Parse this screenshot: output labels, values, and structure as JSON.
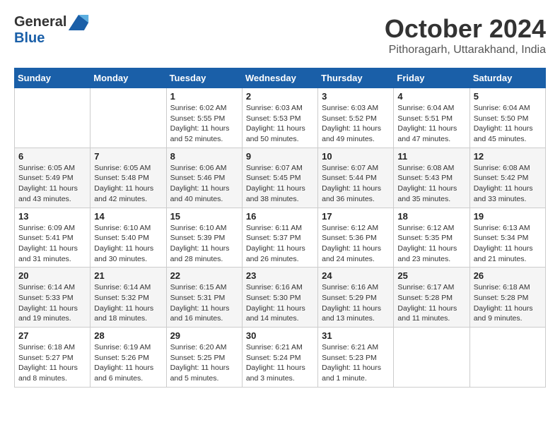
{
  "logo": {
    "line1": "General",
    "line2": "Blue"
  },
  "title": "October 2024",
  "subtitle": "Pithoragarh, Uttarakhand, India",
  "days_of_week": [
    "Sunday",
    "Monday",
    "Tuesday",
    "Wednesday",
    "Thursday",
    "Friday",
    "Saturday"
  ],
  "weeks": [
    [
      {
        "day": "",
        "sunrise": "",
        "sunset": "",
        "daylight": ""
      },
      {
        "day": "",
        "sunrise": "",
        "sunset": "",
        "daylight": ""
      },
      {
        "day": "1",
        "sunrise": "Sunrise: 6:02 AM",
        "sunset": "Sunset: 5:55 PM",
        "daylight": "Daylight: 11 hours and 52 minutes."
      },
      {
        "day": "2",
        "sunrise": "Sunrise: 6:03 AM",
        "sunset": "Sunset: 5:53 PM",
        "daylight": "Daylight: 11 hours and 50 minutes."
      },
      {
        "day": "3",
        "sunrise": "Sunrise: 6:03 AM",
        "sunset": "Sunset: 5:52 PM",
        "daylight": "Daylight: 11 hours and 49 minutes."
      },
      {
        "day": "4",
        "sunrise": "Sunrise: 6:04 AM",
        "sunset": "Sunset: 5:51 PM",
        "daylight": "Daylight: 11 hours and 47 minutes."
      },
      {
        "day": "5",
        "sunrise": "Sunrise: 6:04 AM",
        "sunset": "Sunset: 5:50 PM",
        "daylight": "Daylight: 11 hours and 45 minutes."
      }
    ],
    [
      {
        "day": "6",
        "sunrise": "Sunrise: 6:05 AM",
        "sunset": "Sunset: 5:49 PM",
        "daylight": "Daylight: 11 hours and 43 minutes."
      },
      {
        "day": "7",
        "sunrise": "Sunrise: 6:05 AM",
        "sunset": "Sunset: 5:48 PM",
        "daylight": "Daylight: 11 hours and 42 minutes."
      },
      {
        "day": "8",
        "sunrise": "Sunrise: 6:06 AM",
        "sunset": "Sunset: 5:46 PM",
        "daylight": "Daylight: 11 hours and 40 minutes."
      },
      {
        "day": "9",
        "sunrise": "Sunrise: 6:07 AM",
        "sunset": "Sunset: 5:45 PM",
        "daylight": "Daylight: 11 hours and 38 minutes."
      },
      {
        "day": "10",
        "sunrise": "Sunrise: 6:07 AM",
        "sunset": "Sunset: 5:44 PM",
        "daylight": "Daylight: 11 hours and 36 minutes."
      },
      {
        "day": "11",
        "sunrise": "Sunrise: 6:08 AM",
        "sunset": "Sunset: 5:43 PM",
        "daylight": "Daylight: 11 hours and 35 minutes."
      },
      {
        "day": "12",
        "sunrise": "Sunrise: 6:08 AM",
        "sunset": "Sunset: 5:42 PM",
        "daylight": "Daylight: 11 hours and 33 minutes."
      }
    ],
    [
      {
        "day": "13",
        "sunrise": "Sunrise: 6:09 AM",
        "sunset": "Sunset: 5:41 PM",
        "daylight": "Daylight: 11 hours and 31 minutes."
      },
      {
        "day": "14",
        "sunrise": "Sunrise: 6:10 AM",
        "sunset": "Sunset: 5:40 PM",
        "daylight": "Daylight: 11 hours and 30 minutes."
      },
      {
        "day": "15",
        "sunrise": "Sunrise: 6:10 AM",
        "sunset": "Sunset: 5:39 PM",
        "daylight": "Daylight: 11 hours and 28 minutes."
      },
      {
        "day": "16",
        "sunrise": "Sunrise: 6:11 AM",
        "sunset": "Sunset: 5:37 PM",
        "daylight": "Daylight: 11 hours and 26 minutes."
      },
      {
        "day": "17",
        "sunrise": "Sunrise: 6:12 AM",
        "sunset": "Sunset: 5:36 PM",
        "daylight": "Daylight: 11 hours and 24 minutes."
      },
      {
        "day": "18",
        "sunrise": "Sunrise: 6:12 AM",
        "sunset": "Sunset: 5:35 PM",
        "daylight": "Daylight: 11 hours and 23 minutes."
      },
      {
        "day": "19",
        "sunrise": "Sunrise: 6:13 AM",
        "sunset": "Sunset: 5:34 PM",
        "daylight": "Daylight: 11 hours and 21 minutes."
      }
    ],
    [
      {
        "day": "20",
        "sunrise": "Sunrise: 6:14 AM",
        "sunset": "Sunset: 5:33 PM",
        "daylight": "Daylight: 11 hours and 19 minutes."
      },
      {
        "day": "21",
        "sunrise": "Sunrise: 6:14 AM",
        "sunset": "Sunset: 5:32 PM",
        "daylight": "Daylight: 11 hours and 18 minutes."
      },
      {
        "day": "22",
        "sunrise": "Sunrise: 6:15 AM",
        "sunset": "Sunset: 5:31 PM",
        "daylight": "Daylight: 11 hours and 16 minutes."
      },
      {
        "day": "23",
        "sunrise": "Sunrise: 6:16 AM",
        "sunset": "Sunset: 5:30 PM",
        "daylight": "Daylight: 11 hours and 14 minutes."
      },
      {
        "day": "24",
        "sunrise": "Sunrise: 6:16 AM",
        "sunset": "Sunset: 5:29 PM",
        "daylight": "Daylight: 11 hours and 13 minutes."
      },
      {
        "day": "25",
        "sunrise": "Sunrise: 6:17 AM",
        "sunset": "Sunset: 5:28 PM",
        "daylight": "Daylight: 11 hours and 11 minutes."
      },
      {
        "day": "26",
        "sunrise": "Sunrise: 6:18 AM",
        "sunset": "Sunset: 5:28 PM",
        "daylight": "Daylight: 11 hours and 9 minutes."
      }
    ],
    [
      {
        "day": "27",
        "sunrise": "Sunrise: 6:18 AM",
        "sunset": "Sunset: 5:27 PM",
        "daylight": "Daylight: 11 hours and 8 minutes."
      },
      {
        "day": "28",
        "sunrise": "Sunrise: 6:19 AM",
        "sunset": "Sunset: 5:26 PM",
        "daylight": "Daylight: 11 hours and 6 minutes."
      },
      {
        "day": "29",
        "sunrise": "Sunrise: 6:20 AM",
        "sunset": "Sunset: 5:25 PM",
        "daylight": "Daylight: 11 hours and 5 minutes."
      },
      {
        "day": "30",
        "sunrise": "Sunrise: 6:21 AM",
        "sunset": "Sunset: 5:24 PM",
        "daylight": "Daylight: 11 hours and 3 minutes."
      },
      {
        "day": "31",
        "sunrise": "Sunrise: 6:21 AM",
        "sunset": "Sunset: 5:23 PM",
        "daylight": "Daylight: 11 hours and 1 minute."
      },
      {
        "day": "",
        "sunrise": "",
        "sunset": "",
        "daylight": ""
      },
      {
        "day": "",
        "sunrise": "",
        "sunset": "",
        "daylight": ""
      }
    ]
  ]
}
